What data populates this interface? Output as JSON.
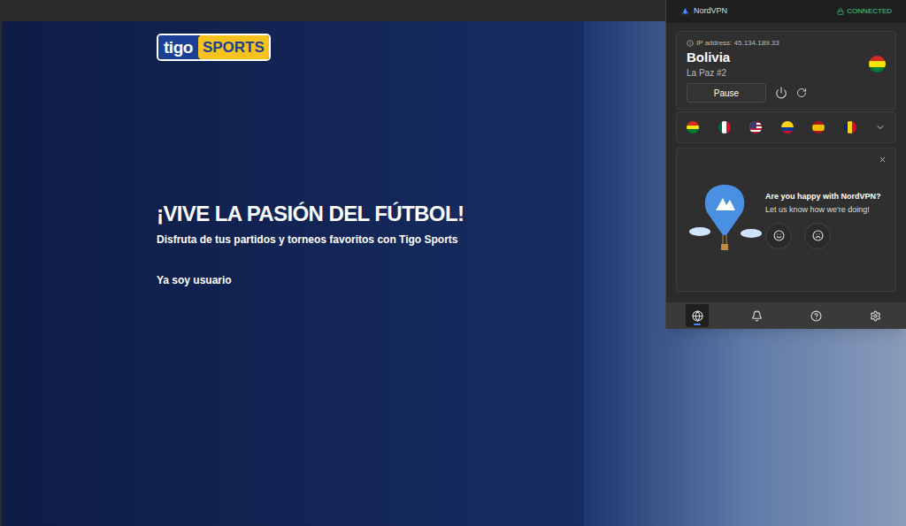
{
  "page": {
    "logo": {
      "brand": "tigo",
      "product": "SPORTS"
    },
    "heading": "¡VIVE LA PASIÓN DEL FÚTBOL!",
    "subtitle": "Disfruta de tus partidos y torneos favoritos con Tigo Sports",
    "login_link": "Ya soy usuario"
  },
  "vpn": {
    "app_name": "NordVPN",
    "status": "CONNECTED",
    "connected": true,
    "ip_label": "IP address: 45.134.189.33",
    "country": "Bolivia",
    "server": "La Paz #2",
    "flag": {
      "kind": "horizontal",
      "colors": [
        "#d52b1e",
        "#f9e300",
        "#007934"
      ]
    },
    "pause_button": "Pause",
    "recent_flags": [
      {
        "kind": "horizontal",
        "colors": [
          "#d52b1e",
          "#f9e300",
          "#007934"
        ]
      },
      {
        "kind": "vertical",
        "colors": [
          "#006847",
          "#ffffff",
          "#ce1126"
        ]
      },
      {
        "kind": "us",
        "colors": [
          "#b22234",
          "#ffffff",
          "#3c3b6e"
        ]
      },
      {
        "kind": "horizontal",
        "colors": [
          "#fcd116",
          "#fcd116",
          "#003893",
          "#ce1126"
        ]
      },
      {
        "kind": "horizontal",
        "colors": [
          "#aa151b",
          "#f1bf00",
          "#f1bf00",
          "#aa151b"
        ]
      },
      {
        "kind": "vertical",
        "colors": [
          "#002b7f",
          "#fcd116",
          "#ce1126"
        ]
      }
    ],
    "feedback": {
      "title": "Are you happy with NordVPN?",
      "subtitle": "Let us know how we're doing!"
    },
    "nav": [
      {
        "selected": true
      },
      {
        "selected": false
      },
      {
        "selected": false
      },
      {
        "selected": false
      }
    ]
  }
}
